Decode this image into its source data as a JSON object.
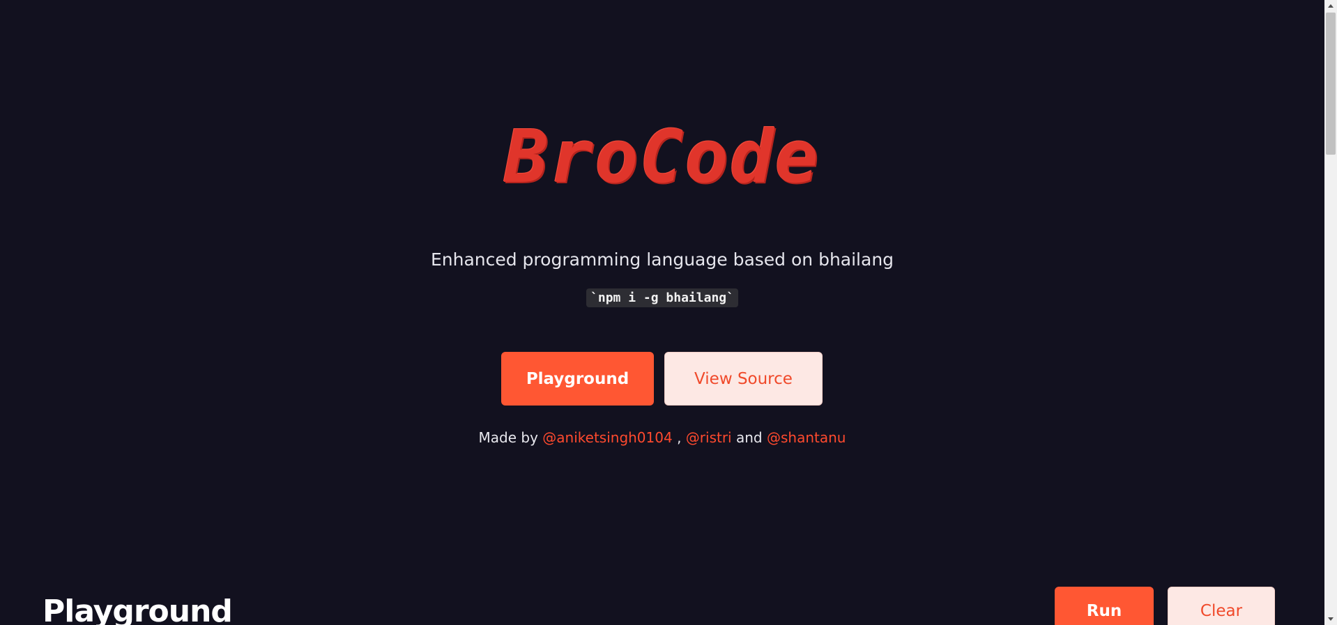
{
  "hero": {
    "logo_text": "BroCode",
    "tagline": "Enhanced programming language based on bhailang",
    "install_command": "`npm i -g bhailang`",
    "primary_button": "Playground",
    "secondary_button": "View Source"
  },
  "credits": {
    "prefix": "Made by",
    "author1": "@aniketsingh0104",
    "sep1": ",",
    "author2": "@ristri",
    "sep2": "and",
    "author3": "@shantanu"
  },
  "playground": {
    "title": "Playground",
    "run_label": "Run",
    "clear_label": "Clear"
  },
  "colors": {
    "background": "#12111f",
    "accent": "#ff5733",
    "secondary_bg": "#fde8e4",
    "link": "#ff4a2e"
  }
}
